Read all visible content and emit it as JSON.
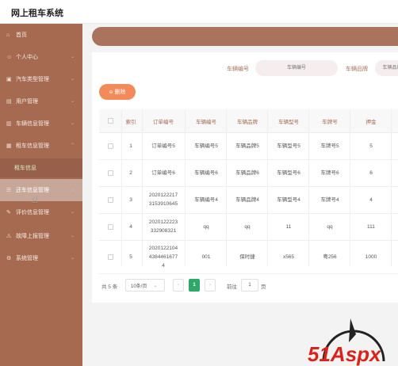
{
  "app": {
    "title": "网上租车系统"
  },
  "sidebar": {
    "items": [
      {
        "label": "首页",
        "icon": "home-icon",
        "glyph": "⌂"
      },
      {
        "label": "个人中心",
        "icon": "user-icon",
        "glyph": "☺"
      },
      {
        "label": "汽车类型管理",
        "icon": "car-icon",
        "glyph": "▣"
      },
      {
        "label": "用户管理",
        "icon": "users-icon",
        "glyph": "▤"
      },
      {
        "label": "车辆信息管理",
        "icon": "vehicle-icon",
        "glyph": "▥"
      },
      {
        "label": "租车信息管理",
        "icon": "rent-icon",
        "glyph": "▦"
      }
    ],
    "submenu_label": "租车信息",
    "items2": [
      {
        "label": "还车信息管理",
        "icon": "return-icon",
        "glyph": "☰"
      },
      {
        "label": "评价信息管理",
        "icon": "comment-icon",
        "glyph": "✎"
      },
      {
        "label": "故障上报管理",
        "icon": "report-icon",
        "glyph": "⚠"
      },
      {
        "label": "系统管理",
        "icon": "settings-icon",
        "glyph": "⚙"
      }
    ]
  },
  "search": {
    "vehicle_no_label": "车辆编号",
    "vehicle_no_placeholder": "车辆编号",
    "brand_label": "车辆品牌",
    "brand_placeholder": "车辆品牌"
  },
  "toolbar": {
    "delete_label": "删除",
    "delete_icon": "⊖"
  },
  "table": {
    "columns": [
      "索引",
      "订单编号",
      "车辆编号",
      "车辆品牌",
      "车辆型号",
      "车牌号",
      "押金",
      "日"
    ],
    "rows": [
      {
        "index": "1",
        "order_no": "订单编号5",
        "vehicle_no": "车辆编号5",
        "brand": "车辆品牌5",
        "model": "车辆型号5",
        "plate": "车牌号5",
        "deposit": "5"
      },
      {
        "index": "2",
        "order_no": "订单编号6",
        "vehicle_no": "车辆编号6",
        "brand": "车辆品牌6",
        "model": "车辆型号6",
        "plate": "车牌号6",
        "deposit": "6"
      },
      {
        "index": "3",
        "order_no_1": "2020122217",
        "order_no_2": "3153910645",
        "vehicle_no": "车辆编号4",
        "brand": "车辆品牌4",
        "model": "车辆型号4",
        "plate": "车牌号4",
        "deposit": "4"
      },
      {
        "index": "4",
        "order_no_1": "2020122223",
        "order_no_2": "332908321",
        "vehicle_no": "qq",
        "brand": "qq",
        "model": "11",
        "plate": "qq",
        "deposit": "111"
      },
      {
        "index": "5",
        "order_no_1": "2020122104",
        "order_no_2": "4384461677",
        "order_no_3": "4",
        "vehicle_no": "001",
        "brand": "保时捷",
        "model": "x565",
        "plate": "粤256",
        "deposit": "1000"
      }
    ]
  },
  "pagination": {
    "total": "共 5 条",
    "page_size": "10条/页",
    "page_size_chevron": "⌄",
    "prev": "‹",
    "current": "1",
    "next": "›",
    "goto_label": "前往",
    "goto_value": "1",
    "page_suffix": "页"
  },
  "watermark": {
    "text": "51Aspx"
  }
}
